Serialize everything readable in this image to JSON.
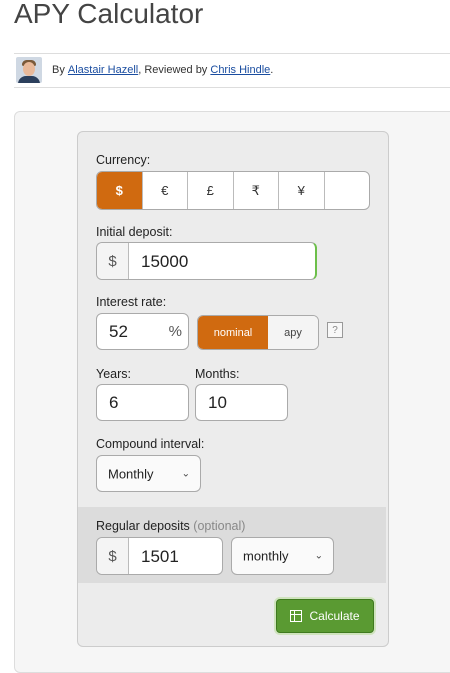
{
  "page": {
    "title": "APY Calculator"
  },
  "byline": {
    "by": "By",
    "author": "Alastair Hazell",
    "reviewed": ", Reviewed by",
    "reviewer": "Chris Hindle",
    "end": "."
  },
  "calculator": {
    "currency_label": "Currency:",
    "currencies": [
      "$",
      "€",
      "£",
      "₹",
      "¥",
      ""
    ],
    "selected_currency": "$",
    "initial_deposit_label": "Initial deposit:",
    "initial_deposit_prefix": "$",
    "initial_deposit": "15000",
    "interest_rate_label": "Interest rate:",
    "interest_rate": "52",
    "interest_suffix": "%",
    "rate_type_options": [
      "nominal",
      "apy"
    ],
    "selected_rate_type": "nominal",
    "help": "?",
    "years_label": "Years:",
    "years": "6",
    "months_label": "Months:",
    "months": "10",
    "compound_label": "Compound interval:",
    "compound_value": "Monthly",
    "regular_label": "Regular deposits",
    "regular_optional": "(optional)",
    "regular_prefix": "$",
    "regular_value": "1501",
    "regular_frequency": "monthly",
    "calculate_label": "Calculate"
  },
  "colors": {
    "accent": "#d06a10",
    "calculate": "#5a9a32",
    "link": "#1a4da0"
  }
}
